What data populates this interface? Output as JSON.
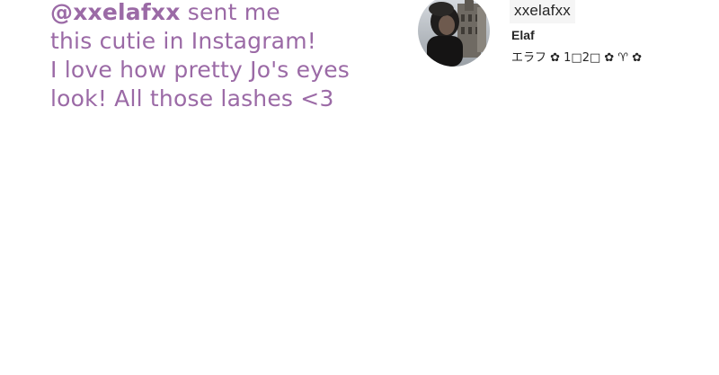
{
  "caption": {
    "handle": "@xxelafxx",
    "line1_rest": " sent me",
    "line2": "this cutie in Instagram!",
    "line3": "I love how pretty Jo's eyes",
    "line4": "look! All those lashes <3",
    "color": "#9b6aa6"
  },
  "profile": {
    "username": "xxelafxx",
    "display_name": "Elaf",
    "bio": "エラフ ✿ 1□2□ ✿ ♈ ✿",
    "avatar_icon": "profile-photo"
  }
}
